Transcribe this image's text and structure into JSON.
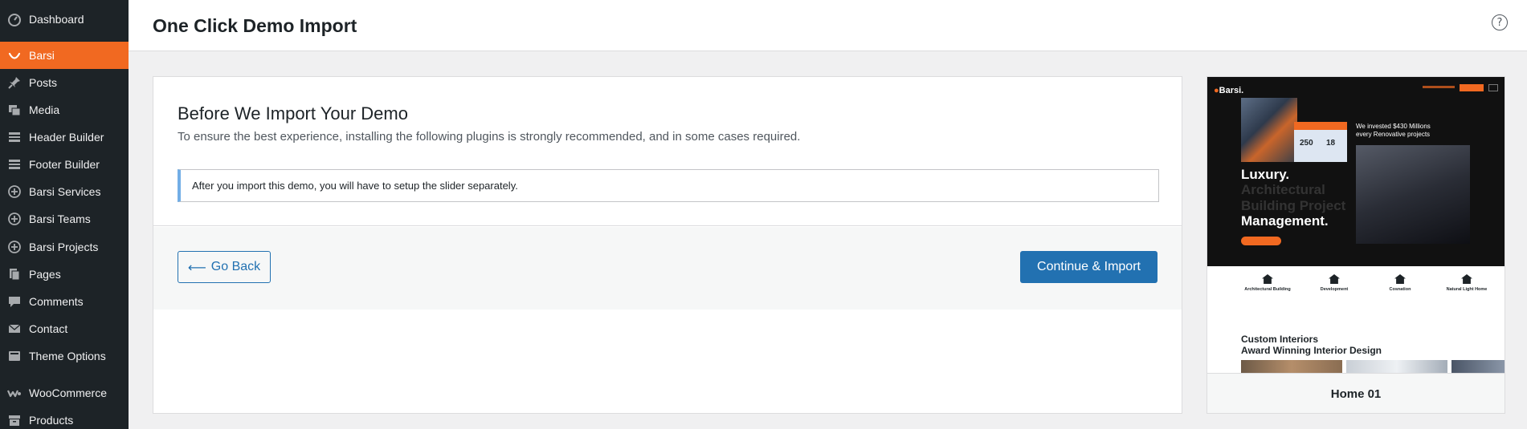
{
  "sidebar": {
    "items": [
      {
        "label": "Dashboard",
        "icon": "dashboard-icon"
      },
      {
        "label": "Barsi",
        "icon": "smile-icon",
        "active": true
      },
      {
        "label": "Posts",
        "icon": "pin-icon"
      },
      {
        "label": "Media",
        "icon": "media-icon"
      },
      {
        "label": "Header Builder",
        "icon": "layout-icon"
      },
      {
        "label": "Footer Builder",
        "icon": "layout-icon"
      },
      {
        "label": "Barsi Services",
        "icon": "plus-circle-icon"
      },
      {
        "label": "Barsi Teams",
        "icon": "plus-circle-icon"
      },
      {
        "label": "Barsi Projects",
        "icon": "plus-circle-icon"
      },
      {
        "label": "Pages",
        "icon": "pages-icon"
      },
      {
        "label": "Comments",
        "icon": "comment-icon"
      },
      {
        "label": "Contact",
        "icon": "mail-icon"
      },
      {
        "label": "Theme Options",
        "icon": "palette-icon"
      },
      {
        "label": "WooCommerce",
        "icon": "woo-icon"
      },
      {
        "label": "Products",
        "icon": "archive-icon"
      }
    ]
  },
  "header": {
    "title": "One Click Demo Import",
    "help_glyph": "?"
  },
  "main": {
    "heading": "Before We Import Your Demo",
    "description": "To ensure the best experience, installing the following plugins is strongly recommended, and in some cases required.",
    "notice": "After you import this demo, you will have to setup the slider separately.",
    "back_arrow": "⟵",
    "back_label": "Go Back",
    "continue_label": "Continue & Import"
  },
  "preview": {
    "logo": "Barsi.",
    "stat1": "250",
    "stat2": "18",
    "invest_text": "We invested $430 Millions every Renovative projects",
    "lux_line1": "Luxury.",
    "lux_line2": "Architectural",
    "lux_line3": "Building Project",
    "lux_line4": "Management.",
    "features": [
      "Architectural Building",
      "Development",
      "Cosnation",
      "Natural Light Home"
    ],
    "custom_line1": "Custom Interiors",
    "custom_line2": "Award Winning Interior Design",
    "demo_name": "Home 01"
  },
  "colors": {
    "sidebar_bg": "#1d2327",
    "accent": "#f16921",
    "primary_button": "#2271b1",
    "notice_border": "#72aee6"
  }
}
